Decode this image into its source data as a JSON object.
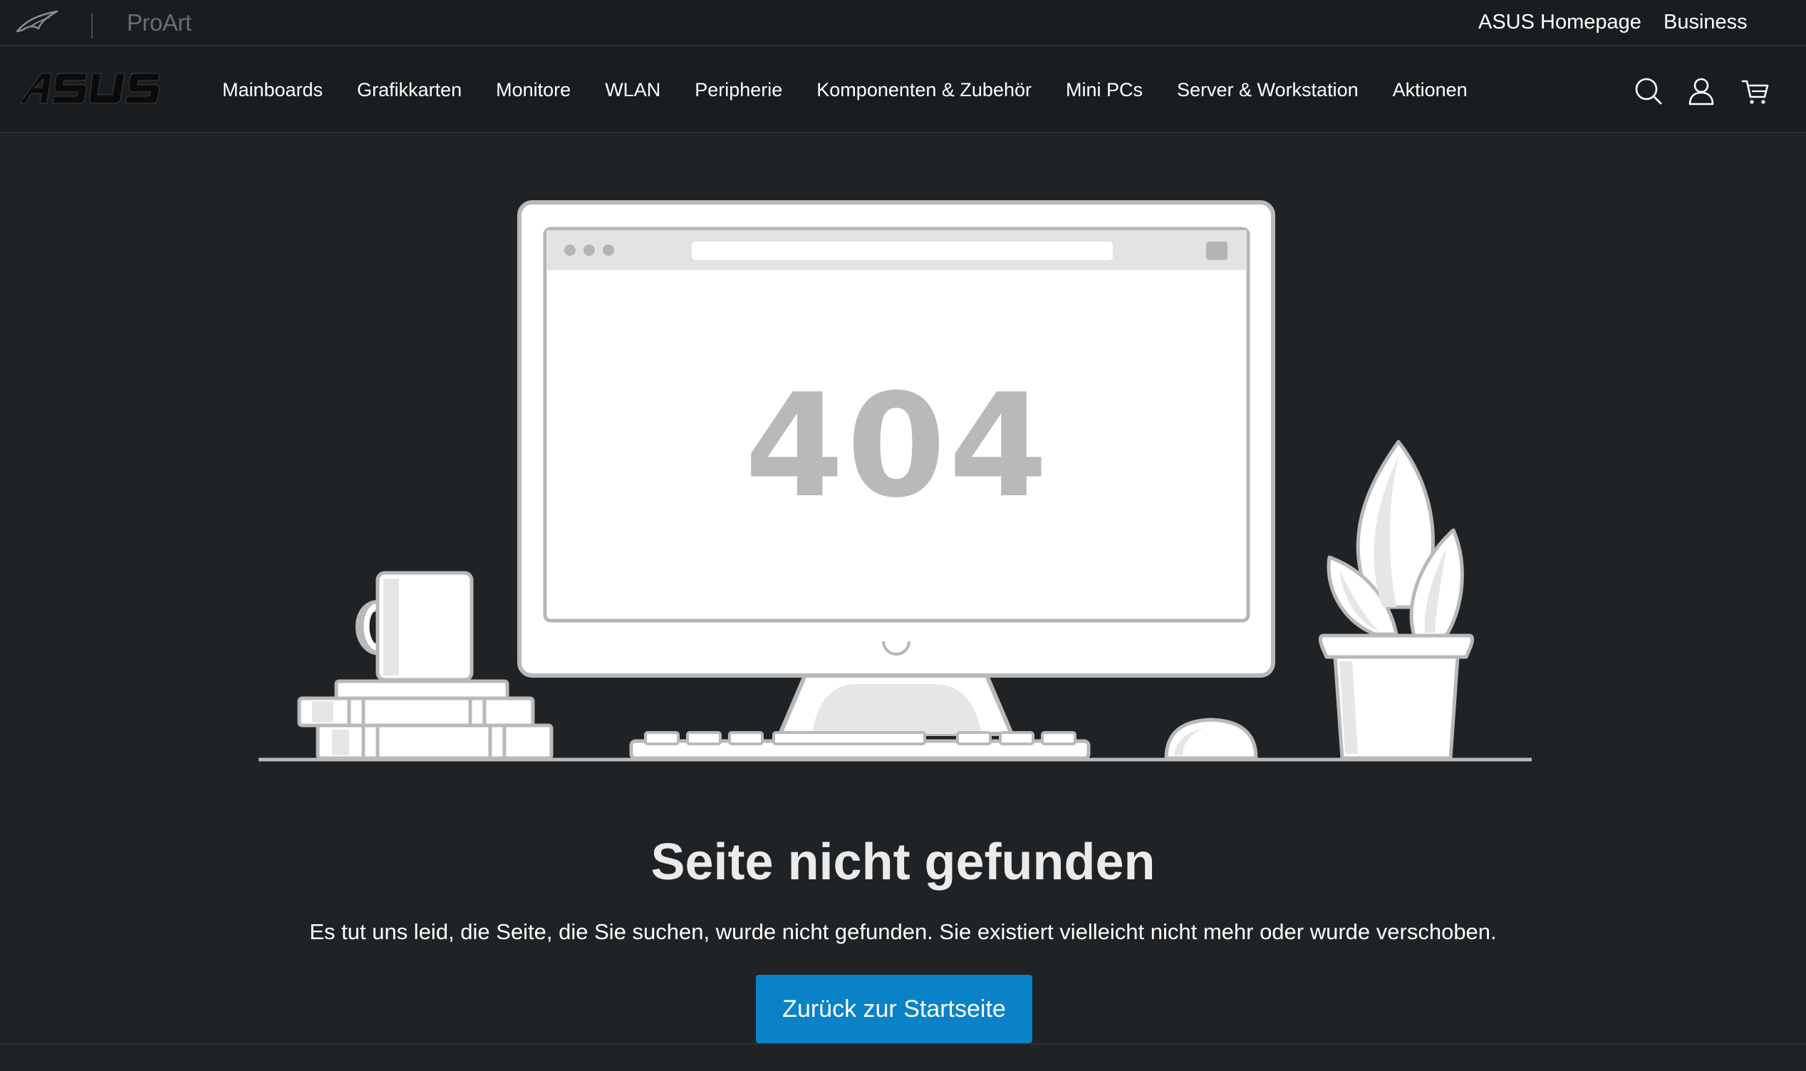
{
  "topbar": {
    "proart_logo": "ProArt",
    "links": {
      "homepage": "ASUS Homepage",
      "business": "Business"
    }
  },
  "nav": {
    "items": [
      {
        "label": "Mainboards"
      },
      {
        "label": "Grafikkarten"
      },
      {
        "label": "Monitore"
      },
      {
        "label": "WLAN"
      },
      {
        "label": "Peripherie"
      },
      {
        "label": "Komponenten & Zubehör"
      },
      {
        "label": "Mini PCs"
      },
      {
        "label": "Server & Workstation"
      },
      {
        "label": "Aktionen"
      }
    ],
    "icons": [
      "search-icon",
      "user-icon",
      "cart-icon"
    ]
  },
  "illustration": {
    "error_code": "404"
  },
  "content": {
    "headline": "Seite nicht gefunden",
    "message": "Es tut uns leid, die Seite, die Sie suchen, wurde nicht gefunden. Sie existiert vielleicht nicht mehr oder wurde verschoben.",
    "button_label": "Zurück zur Startseite"
  },
  "colors": {
    "background": "#202325",
    "header": "#1a1d1f",
    "accent": "#0a82c8",
    "illustration_fill": "#ffffff",
    "illustration_shade": "#e2e2e2",
    "illustration_stroke": "#b5b5b5"
  }
}
